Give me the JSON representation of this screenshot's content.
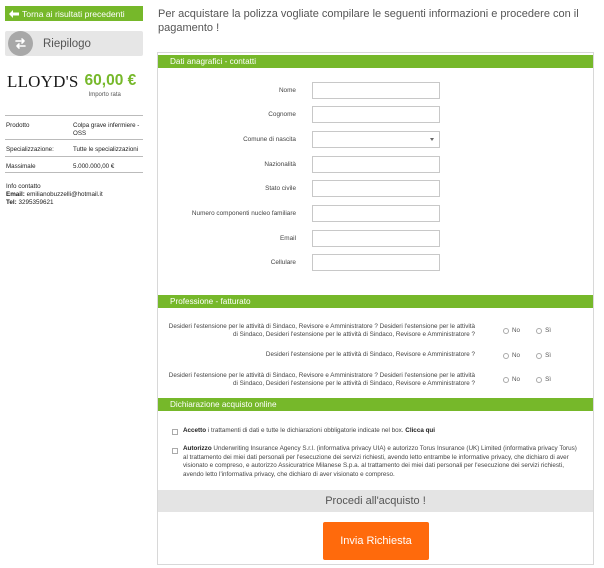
{
  "sidebar": {
    "back_label": "Torna ai risultati precedenti",
    "summary_label": "Riepilogo",
    "brand": "LLOYD'S",
    "price": "60,00 €",
    "price_caption": "Importo rata",
    "info": [
      {
        "key": "Prodotto",
        "value": "Colpa grave infermiere -OSS"
      },
      {
        "key": "Specializzazione:",
        "value": "Tutte le specializzazioni"
      },
      {
        "key": "Massimale",
        "value": "5.000.000,00 €"
      }
    ],
    "contact_title": "Info contatto",
    "email_label": "Email:",
    "email_value": "emilianobuzzelli@hotmail.it",
    "tel_label": "Tel:",
    "tel_value": "3295359621"
  },
  "intro_text": "Per acquistare la polizza vogliate compilare le seguenti informazioni e procedere con il pagamento !",
  "section_contacts": {
    "title": "Dati anagrafici - contatti",
    "fields": [
      {
        "label": "Nome",
        "value": "",
        "type": "text"
      },
      {
        "label": "Cognome",
        "value": "",
        "type": "text"
      },
      {
        "label": "Comune di nascita",
        "value": "",
        "type": "select"
      },
      {
        "label": "Nazionalità",
        "value": "",
        "type": "text"
      },
      {
        "label": "Stato civile",
        "value": "",
        "type": "text"
      },
      {
        "label": "Numero componenti nucleo familiare",
        "value": "",
        "type": "text"
      },
      {
        "label": "Email",
        "value": "",
        "type": "text"
      },
      {
        "label": "Cellulare",
        "value": "",
        "type": "text"
      }
    ]
  },
  "section_profession": {
    "title": "Professione - fatturato",
    "questions": [
      {
        "text": "Desideri l'estensione per le attività di Sindaco, Revisore e Amministratore ? Desideri l'estensione per le attività di Sindaco, Desideri l'estensione per le attività di Sindaco, Revisore e Amministratore ?"
      },
      {
        "text": "Desideri l'estensione per le attività di Sindaco, Revisore e Amministratore ?"
      },
      {
        "text": "Desideri l'estensione per le attività di Sindaco, Revisore e Amministratore ? Desideri l'estensione per le attività di Sindaco, Desideri l'estensione per le attività di Sindaco, Revisore e Amministratore ?"
      }
    ],
    "option_no": "No",
    "option_yes": "Sì"
  },
  "section_declaration": {
    "title": "Dichiarazione acquisto online",
    "accept_bold": "Accetto",
    "accept_text": " i trattamenti di dati e tutte le dichiarazioni obbligatorie indicate nel box.",
    "accept_link": "Clicca qui",
    "authorize_bold": "Autorizzo",
    "authorize_text": " Underwriting Insurance Agency S.r.l. (informativa privacy UIA) e autorizzo Torus Insurance (UK) Limited (informativa privacy Torus) al trattamento dei miei dati personali per l'esecuzione dei servizi richiesti, avendo letto entrambe le informative privacy, che dichiaro di aver visionato e compreso, e autorizzo Assicuratrice Milanese S.p.a. al trattamento dei miei dati personali per l'esecuzione dei servizi richiesti, avendo letto l'informativa privacy, che dichiaro di aver visionato e compreso."
  },
  "proceed_label": "Procedi all'acquisto !",
  "submit_label": "Invia Richiesta",
  "colors": {
    "accent": "#76b82a",
    "cta": "#ff6a0c"
  }
}
